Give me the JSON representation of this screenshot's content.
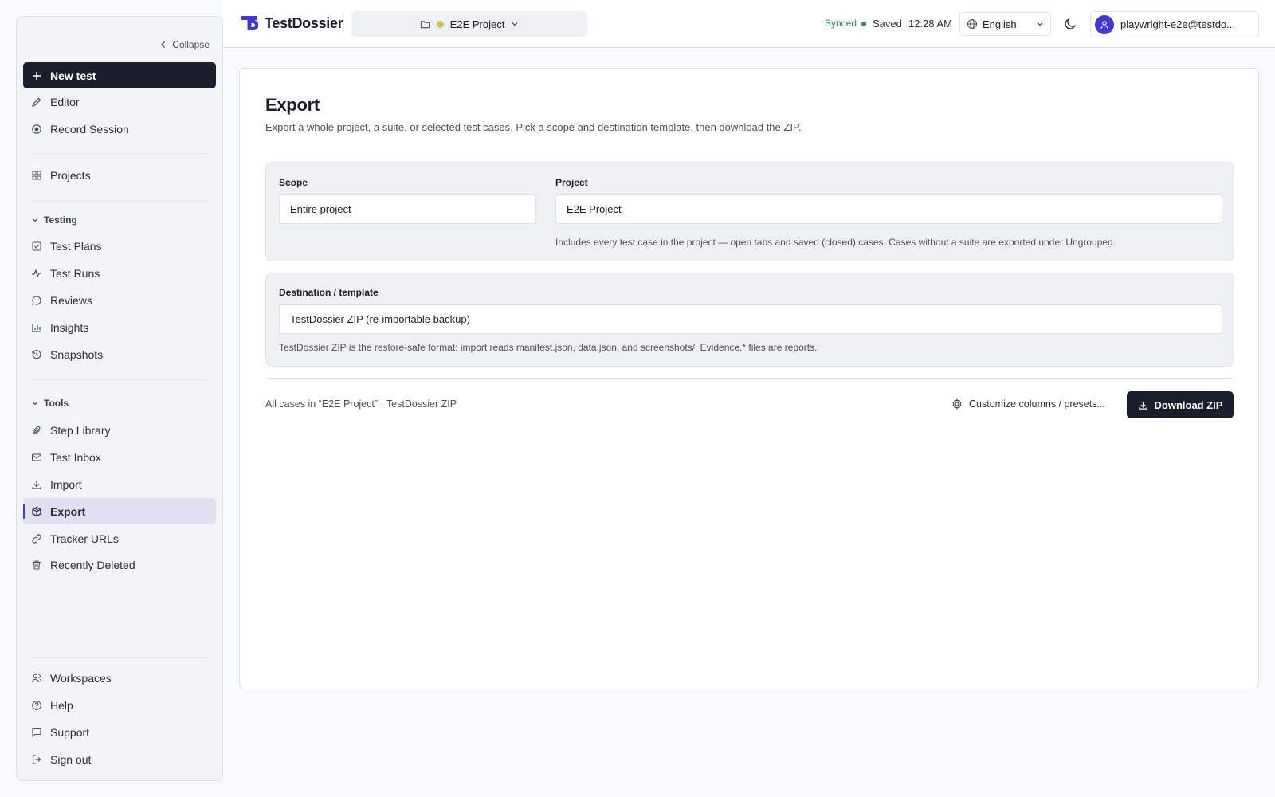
{
  "app": {
    "name": "TestDossier"
  },
  "sidebar": {
    "collapse_label": "Collapse",
    "top_items": [
      {
        "label": "New test",
        "icon": "plus-icon"
      },
      {
        "label": "Editor",
        "icon": "pencil-icon"
      },
      {
        "label": "Record Session",
        "icon": "record-icon"
      }
    ],
    "projects_label": "Projects",
    "testing": {
      "heading": "Testing",
      "items": [
        "Test Plans",
        "Test Runs",
        "Reviews",
        "Insights",
        "Snapshots"
      ]
    },
    "tools": {
      "heading": "Tools",
      "items": [
        "Step Library",
        "Test Inbox",
        "Import",
        "Export",
        "Tracker URLs",
        "Recently Deleted"
      ],
      "active": "Export"
    },
    "bottom_items": [
      "Workspaces",
      "Help",
      "Support",
      "Sign out"
    ]
  },
  "header": {
    "project": "E2E Project",
    "sync_status": "Synced",
    "save_status": "Saved",
    "time": "12:28 AM",
    "language": "English",
    "user": "playwright-e2e@testdo..."
  },
  "export": {
    "title": "Export",
    "subtitle": "Export a whole project, a suite, or selected test cases. Pick a scope and destination template, then download the ZIP.",
    "scope_label": "Scope",
    "scope_value": "Entire project",
    "project_label": "Project",
    "project_value": "E2E Project",
    "project_hint": "Includes every test case in the project — open tabs and saved (closed) cases. Cases without a suite are exported under Ungrouped.",
    "destination_label": "Destination / template",
    "destination_value": "TestDossier ZIP (re-importable backup)",
    "destination_hint": "TestDossier ZIP is the restore-safe format: import reads manifest.json, data.json, and screenshots/. Evidence.* files are reports.",
    "summary": "All cases in “E2E Project” · TestDossier ZIP",
    "customize_label": "Customize columns / presets...",
    "download_label": "Download ZIP"
  },
  "colors": {
    "accent": "#4338ca",
    "primary": "#1b1f2b",
    "success": "#2f8a52",
    "project_dot": "#c9c45a"
  }
}
